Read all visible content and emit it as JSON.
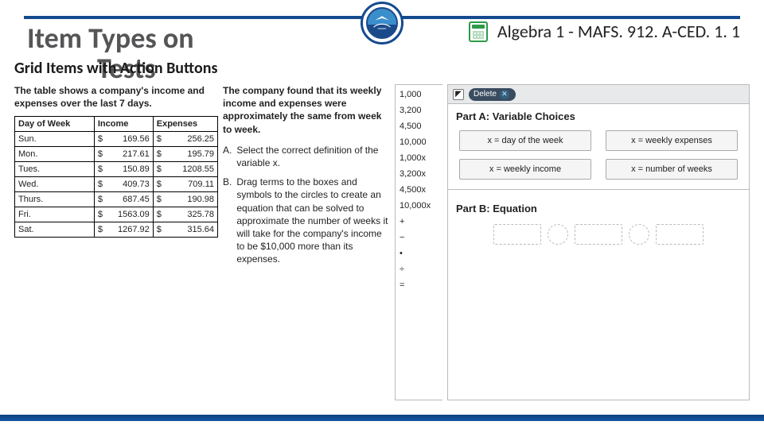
{
  "header": {
    "title_main": "Item Types on",
    "title_overlay": "Tests",
    "subtitle": "Grid Items with Action Buttons",
    "standard": "Algebra 1 - MAFS. 912. A-CED. 1. 1",
    "calc_icon_name": "calculator-icon",
    "logo_name": "district-logo"
  },
  "left": {
    "intro": "The table shows a company's income and expenses over the last 7 days.",
    "columns": [
      "Day of Week",
      "Income",
      "Expenses"
    ],
    "currency": "$",
    "rows": [
      {
        "day": "Sun.",
        "income": "169.56",
        "expenses": "256.25"
      },
      {
        "day": "Mon.",
        "income": "217.61",
        "expenses": "195.79"
      },
      {
        "day": "Tues.",
        "income": "150.89",
        "expenses": "1208.55"
      },
      {
        "day": "Wed.",
        "income": "409.73",
        "expenses": "709.11"
      },
      {
        "day": "Thurs.",
        "income": "687.45",
        "expenses": "190.98"
      },
      {
        "day": "Fri.",
        "income": "1563.09",
        "expenses": "325.78"
      },
      {
        "day": "Sat.",
        "income": "1267.92",
        "expenses": "315.64"
      }
    ]
  },
  "mid": {
    "para": "The company found that its weekly income and expenses were approximately the same from week to week.",
    "items": [
      {
        "label": "A.",
        "text": "Select the correct definition of the variable x."
      },
      {
        "label": "B.",
        "text": "Drag terms to the boxes and symbols to the circles to create an equation that can be solved to approximate the number of weeks it will take for the company's income to be $10,000 more than its expenses."
      }
    ]
  },
  "terms": {
    "items": [
      "1,000",
      "3,200",
      "4,500",
      "10,000",
      "1,000x",
      "3,200x",
      "4,500x",
      "10,000x",
      "+",
      "−",
      "•",
      "÷",
      "="
    ]
  },
  "right": {
    "toolbar": {
      "delete_label": "Delete",
      "pointer_icon": "pointer-icon",
      "close_icon": "close-x-icon"
    },
    "partA": {
      "title": "Part A: Variable Choices",
      "choices": [
        "x = day of the week",
        "x = weekly expenses",
        "x = weekly income",
        "x = number of weeks"
      ]
    },
    "partB": {
      "title": "Part B: Equation",
      "slots": [
        "rect",
        "circ",
        "rect",
        "circ",
        "rect"
      ]
    }
  },
  "colors": {
    "accent_blue": "#144a8e",
    "toolbar_gray": "#e7e9eb",
    "choice_bg": "#f5f5f5"
  }
}
